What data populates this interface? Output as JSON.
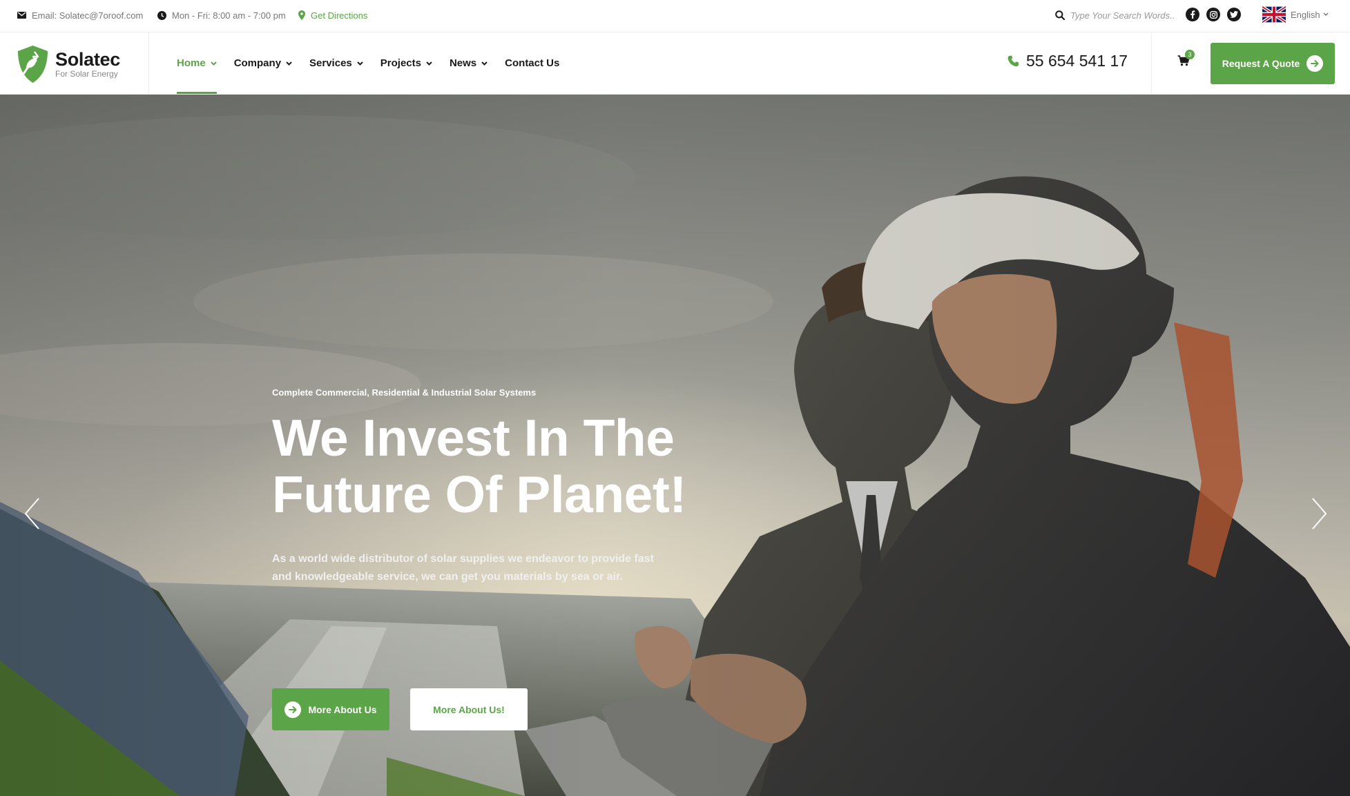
{
  "topbar": {
    "email": "Email: Solatec@7oroof.com",
    "hours": "Mon - Fri: 8:00 am - 7:00 pm",
    "directions": "Get Directions",
    "search_placeholder": "Type Your Search Words..",
    "language": "English"
  },
  "brand": {
    "name": "Solatec",
    "tagline": "For Solar Energy"
  },
  "nav": {
    "items": [
      {
        "label": "Home",
        "active": true
      },
      {
        "label": "Company"
      },
      {
        "label": "Services"
      },
      {
        "label": "Projects"
      },
      {
        "label": "News"
      },
      {
        "label": "Contact Us"
      }
    ]
  },
  "header": {
    "phone": "55 654 541 17",
    "cart_count": "3",
    "quote_label": "Request A Quote"
  },
  "hero": {
    "eyebrow": "Complete Commercial, Residential & Industrial Solar Systems",
    "headline_line1": "We Invest In The",
    "headline_line2": "Future Of Planet!",
    "lead_line1": "As a world wide distributor of solar supplies we endeavor to provide fast",
    "lead_line2": "and knowledgeable service, we can get you materials by sea or air.",
    "primary_button": "More About Us",
    "secondary_button": "More About Us!"
  },
  "colors": {
    "accent": "#5ba548",
    "text_dark": "#1a1a1a",
    "text_muted": "#777777"
  }
}
